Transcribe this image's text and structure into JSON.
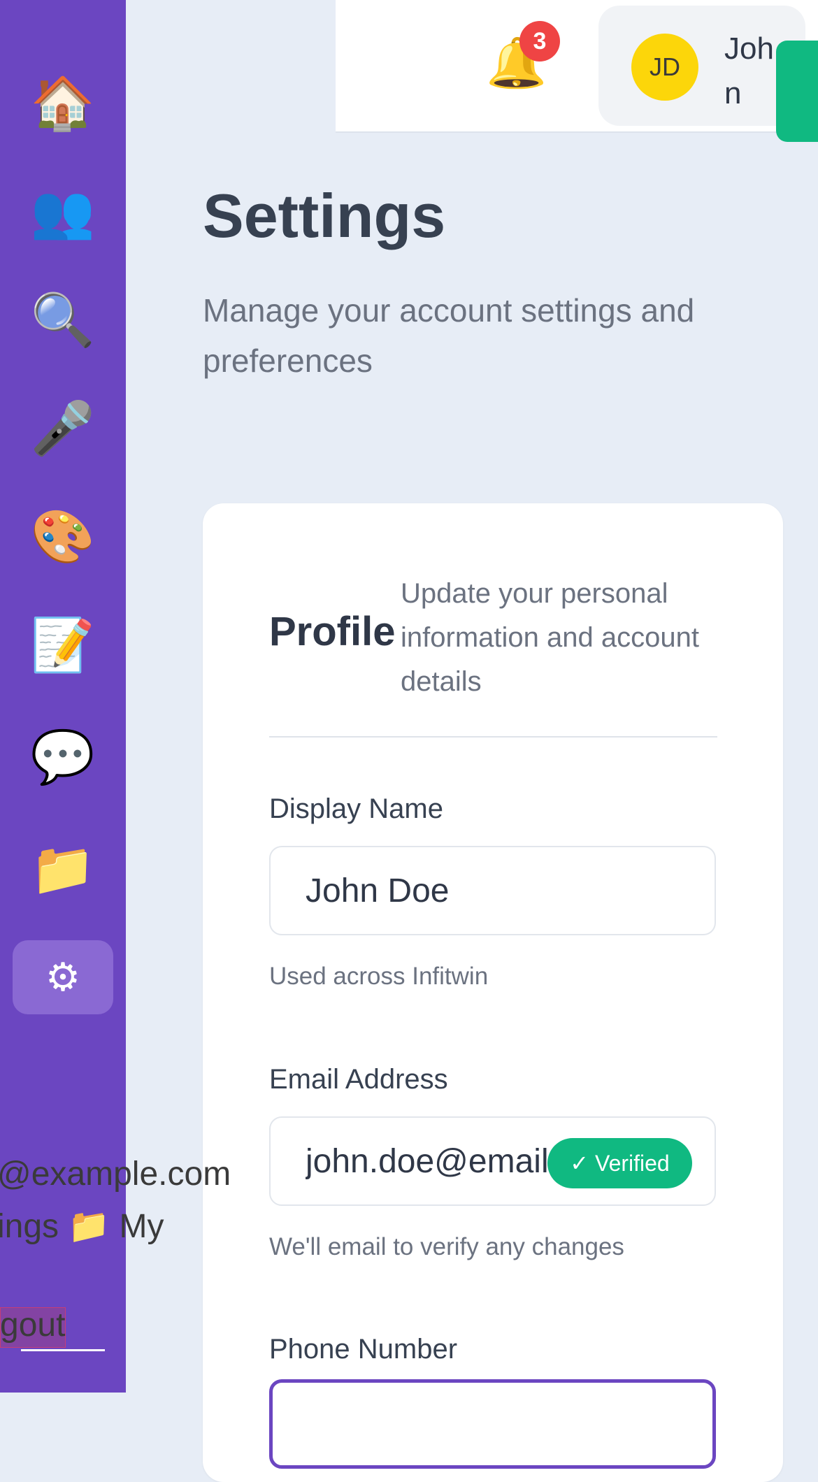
{
  "sidebar": {
    "items": [
      {
        "name": "house-icon",
        "glyph": "🏠"
      },
      {
        "name": "people-icon",
        "glyph": "👥"
      },
      {
        "name": "magnifier-icon",
        "glyph": "🔍"
      },
      {
        "name": "microphone-icon",
        "glyph": "🎤"
      },
      {
        "name": "palette-icon",
        "glyph": "🎨"
      },
      {
        "name": "memo-icon",
        "glyph": "📝"
      },
      {
        "name": "speech-bubble-icon",
        "glyph": "💬"
      },
      {
        "name": "folder-icon",
        "glyph": "📁"
      },
      {
        "name": "gear-icon",
        "glyph": "⚙"
      }
    ],
    "overflow_email": "@example.com",
    "overflow_links": "ings 📁 My",
    "overflow_logout": "gout",
    "accent": "#6b46c1"
  },
  "topbar": {
    "notification_count": "3",
    "bell_glyph": "🔔",
    "avatar_initials": "JD",
    "user_name": "John Doe"
  },
  "page": {
    "title": "Settings",
    "subtitle": "Manage your account settings and preferences"
  },
  "profile": {
    "title": "Profile",
    "description": "Update your personal information and account details",
    "display_name": {
      "label": "Display Name",
      "value": "John Doe",
      "helper": "Used across Infitwin"
    },
    "email": {
      "label": "Email Address",
      "value": "john.doe@email.com",
      "badge": "✓ Verified",
      "helper": "We'll email to verify any changes"
    },
    "phone": {
      "label": "Phone Number"
    }
  },
  "colors": {
    "verified": "#10b981",
    "badge": "#ef4444",
    "background": "#e7edf6"
  }
}
